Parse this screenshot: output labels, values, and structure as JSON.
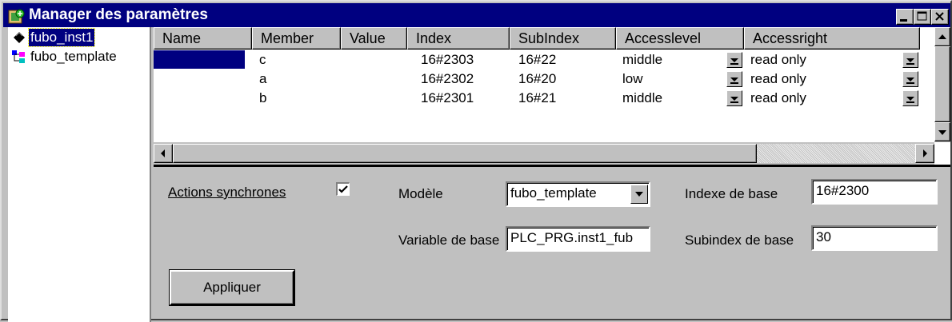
{
  "window": {
    "title": "Manager des paramètres"
  },
  "tree": {
    "items": [
      {
        "label": "fubo_inst1",
        "selected": true,
        "icon": "diamond-instance-icon"
      },
      {
        "label": "fubo_template",
        "selected": false,
        "icon": "template-tree-icon"
      }
    ]
  },
  "grid": {
    "columns": [
      "Name",
      "Member",
      "Value",
      "Index",
      "SubIndex",
      "Accesslevel",
      "Accessright"
    ],
    "rows": [
      {
        "name": "",
        "member": "c",
        "value": "",
        "index": "16#2303",
        "subindex": "16#22",
        "accesslevel": "middle",
        "accessright": "read only"
      },
      {
        "name": "",
        "member": "a",
        "value": "",
        "index": "16#2302",
        "subindex": "16#20",
        "accesslevel": "low",
        "accessright": "read only"
      },
      {
        "name": "",
        "member": "b",
        "value": "",
        "index": "16#2301",
        "subindex": "16#21",
        "accesslevel": "middle",
        "accessright": "read only"
      }
    ]
  },
  "form": {
    "sync_actions_label": "Actions synchrones",
    "sync_actions_checked": true,
    "model_label": "Modèle",
    "model_value": "fubo_template",
    "base_index_label": "Indexe de base",
    "base_index_value": "16#2300",
    "base_variable_label": "Variable de base",
    "base_variable_value": "PLC_PRG.inst1_fub",
    "base_subindex_label": "Subindex de base",
    "base_subindex_value": "30",
    "apply_label": "Appliquer"
  },
  "colors": {
    "titlebar": "#000080",
    "selection": "#000080",
    "face": "#c0c0c0"
  }
}
